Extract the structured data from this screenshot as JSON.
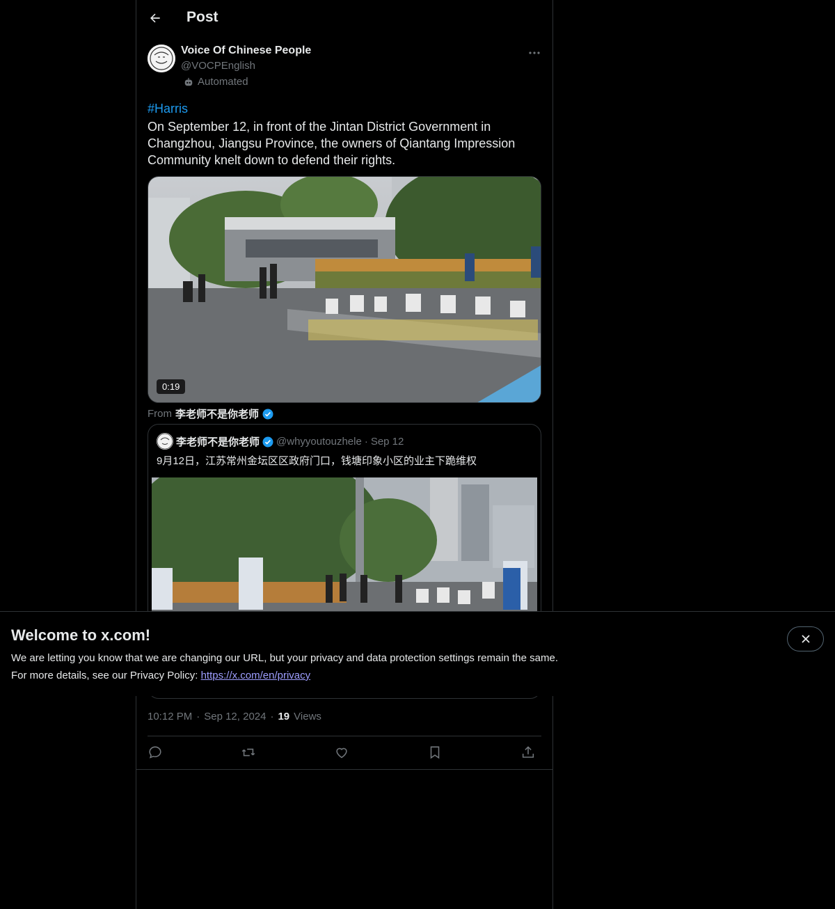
{
  "header": {
    "title": "Post"
  },
  "author": {
    "display_name": "Voice Of Chinese People",
    "handle": "@VOCPEnglish",
    "label": "Automated"
  },
  "post": {
    "hashtag": "#Harris",
    "text": "On September 12, in front of the Jintan District Government in Changzhou, Jiangsu Province, the owners of Qiantang Impression Community knelt down to defend their rights.",
    "video_duration": "0:19",
    "from_prefix": "From",
    "from_name": "李老师不是你老师"
  },
  "quote": {
    "name": "李老师不是你老师",
    "handle": "@whyyoutouzhele",
    "separator": "·",
    "date": "Sep 12",
    "text": "9月12日，江苏常州金坛区区政府门口，钱塘印象小区的业主下跪维权"
  },
  "meta": {
    "time": "10:12 PM",
    "separator": "·",
    "date": "Sep 12, 2024",
    "views_count": "19",
    "views_label": "Views"
  },
  "actions": [
    "reply-icon",
    "repost-icon",
    "like-icon",
    "bookmark-icon",
    "share-icon"
  ],
  "banner": {
    "title": "Welcome to x.com!",
    "line1": "We are letting you know that we are changing our URL, but your privacy and data protection settings remain the same.",
    "line2_prefix": "For more details, see our Privacy Policy: ",
    "link": "https://x.com/en/privacy"
  },
  "colors": {
    "background": "#000000",
    "text": "#e7e9ea",
    "muted": "#71767b",
    "accent": "#1d9bf0",
    "border": "#2f3336",
    "link": "#9e9eff"
  }
}
